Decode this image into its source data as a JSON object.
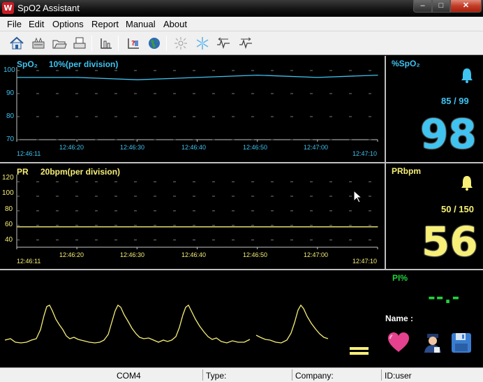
{
  "window": {
    "title": "SpO2 Assistant",
    "icon_letter": "W",
    "minimize_glyph": "–",
    "maximize_glyph": "□",
    "close_glyph": "✕"
  },
  "menu": {
    "items": [
      "File",
      "Edit",
      "Options",
      "Report",
      "Manual",
      "About"
    ]
  },
  "toolbar": {
    "buttons": [
      "home-icon",
      "device-icon",
      "open-folder-icon",
      "print-icon",
      "chart-icon",
      "patient-data-icon",
      "globe-icon",
      "sun-icon",
      "snowflake-icon",
      "trend-left-icon",
      "trend-right-icon"
    ]
  },
  "spo2_trend": {
    "label": "SpO₂",
    "scale": "10%(per division)",
    "y_ticks": [
      "100",
      "90",
      "80",
      "70"
    ],
    "times": [
      "12:46:11",
      "12:46:20",
      "12:46:30",
      "12:46:40",
      "12:46:50",
      "12:47:00",
      "12:47:10"
    ],
    "color": "#3fc3f0"
  },
  "pr_trend": {
    "label": "PR",
    "scale": "20bpm(per division)",
    "y_ticks": [
      "120",
      "100",
      "80",
      "60",
      "40"
    ],
    "times": [
      "12:46:11",
      "12:46:20",
      "12:46:30",
      "12:46:40",
      "12:46:50",
      "12:47:00",
      "12:47:10"
    ],
    "color": "#f7ef76"
  },
  "spo2_readout": {
    "label": "%SpO₂",
    "limits": "85 / 99",
    "value": "98",
    "color": "#3fc3f0"
  },
  "pr_readout": {
    "label": "PRbpm",
    "limits": "50 / 150",
    "value": "56",
    "color": "#f7ef76"
  },
  "pi_readout": {
    "label": "PI%",
    "value": "--.-",
    "color": "#21d33c"
  },
  "patient": {
    "name_label": "Name :"
  },
  "status_bar": {
    "port": "COM4",
    "type_label": "Type:",
    "company_label": "Company:",
    "id_label": "ID:user"
  },
  "chart_data": [
    {
      "type": "line",
      "title": "SpO₂ 10%(per division)",
      "x": [
        "12:46:11",
        "12:46:20",
        "12:46:30",
        "12:46:40",
        "12:46:50",
        "12:47:00",
        "12:47:10"
      ],
      "series": [
        {
          "name": "SpO₂",
          "values": [
            97,
            97,
            96,
            97,
            98,
            97,
            98
          ]
        }
      ],
      "ylim": [
        70,
        100
      ],
      "grid": true
    },
    {
      "type": "line",
      "title": "PR 20bpm(per division)",
      "x": [
        "12:46:11",
        "12:46:20",
        "12:46:30",
        "12:46:40",
        "12:46:50",
        "12:47:00",
        "12:47:10"
      ],
      "series": [
        {
          "name": "PR",
          "values": [
            58,
            58,
            58,
            58,
            58,
            58,
            58
          ]
        }
      ],
      "ylim": [
        30,
        125
      ],
      "grid": true
    }
  ]
}
